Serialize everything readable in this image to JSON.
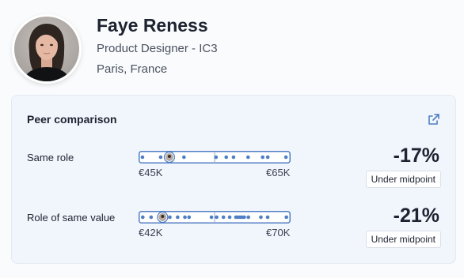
{
  "profile": {
    "name": "Faye Reness",
    "role": "Product Designer - IC3",
    "location": "Paris, France"
  },
  "peer_comparison": {
    "title": "Peer comparison",
    "rows": [
      {
        "label": "Same role",
        "min_label": "€45K",
        "max_label": "€65K",
        "min_value": 45,
        "max_value": 65,
        "peer_values": [
          45.1,
          47.6,
          48.7,
          50.8,
          55.2,
          56.6,
          57.6,
          59.6,
          61.6,
          62.3,
          64.8
        ],
        "self_value": 48.8,
        "midpoint_value": 55,
        "percent": "-17%",
        "badge": "Under midpoint"
      },
      {
        "label": "Role of same value",
        "min_label": "€42K",
        "max_label": "€70K",
        "min_value": 42,
        "max_value": 70,
        "peer_values": [
          42.2,
          43.8,
          45.3,
          47.4,
          48.9,
          50.3,
          51.1,
          55.4,
          56.4,
          57.7,
          58.9,
          60.1,
          60.5,
          60.9,
          61.3,
          61.7,
          62.5,
          64.9,
          66.2,
          69.8
        ],
        "self_value": 46.0,
        "midpoint_value": 56,
        "percent": "-21%",
        "badge": "Under midpoint"
      }
    ]
  },
  "colors": {
    "accent": "#4f7ec3",
    "card_bg": "#f1f5fc",
    "badge_border": "#d9dee7"
  },
  "icons": {
    "expand": "external-link-icon"
  }
}
